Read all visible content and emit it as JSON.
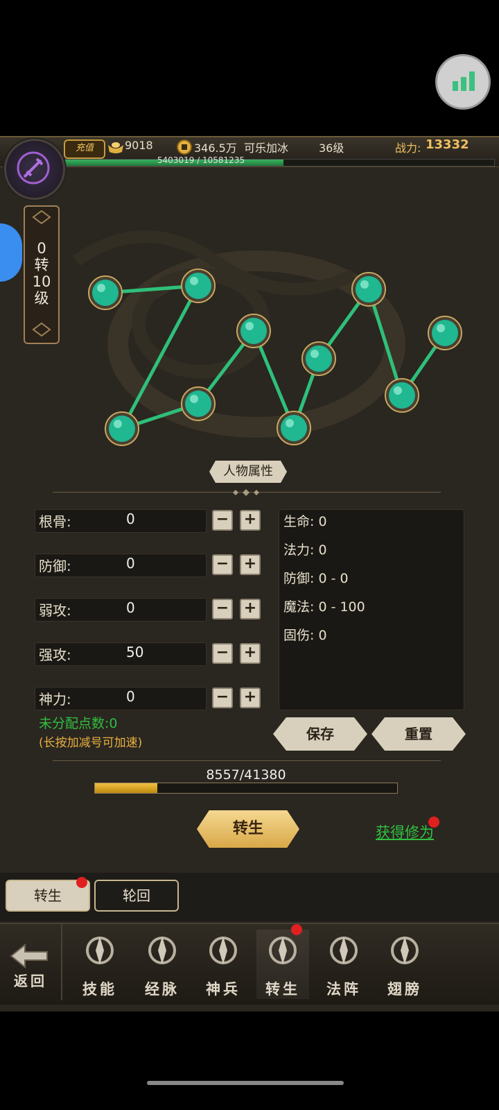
{
  "header": {
    "recharge_label": "充值",
    "ingot": "9018",
    "coins": "346.5万",
    "player_name": "可乐加冰",
    "level": "36级",
    "power_label": "战力:",
    "power_value": "13332",
    "exp_text": "5403019 / 10581235",
    "exp_fraction": 0.51
  },
  "rank": {
    "line1": "0",
    "line2": "转",
    "line3": "10",
    "line4": "级"
  },
  "section_title": "人物属性",
  "stats": [
    {
      "label": "根骨:",
      "value": "0"
    },
    {
      "label": "防御:",
      "value": "0"
    },
    {
      "label": "弱攻:",
      "value": "0"
    },
    {
      "label": "强攻:",
      "value": "50"
    },
    {
      "label": "神力:",
      "value": "0"
    }
  ],
  "minus_symbol": "−",
  "plus_symbol": "+",
  "attributes": [
    "生命: 0",
    "法力: 0",
    "防御: 0 - 0",
    "魔法: 0 - 100",
    "固伤: 0"
  ],
  "unassigned": "未分配点数:0",
  "hint": "(长按加减号可加速)",
  "save_label": "保存",
  "reset_label": "重置",
  "progress_text": "8557/41380",
  "progress_fraction": 0.207,
  "rebirth_label": "转生",
  "get_link": "获得修为",
  "tabs": [
    {
      "label": "转生",
      "active": true
    },
    {
      "label": "轮回",
      "active": false
    }
  ],
  "back_label": "返回",
  "nav": [
    {
      "label": "技能",
      "icon": "skill-icon"
    },
    {
      "label": "经脉",
      "icon": "meridian-icon"
    },
    {
      "label": "神兵",
      "icon": "weapon-icon"
    },
    {
      "label": "转生",
      "icon": "rebirth-icon",
      "active": true
    },
    {
      "label": "法阵",
      "icon": "formation-icon"
    },
    {
      "label": "翅膀",
      "icon": "wings-icon"
    }
  ],
  "colors": {
    "node_green": "#1fb890",
    "line_green": "#2ec07a",
    "link_green": "#30c040",
    "gold": "#f0c060"
  }
}
